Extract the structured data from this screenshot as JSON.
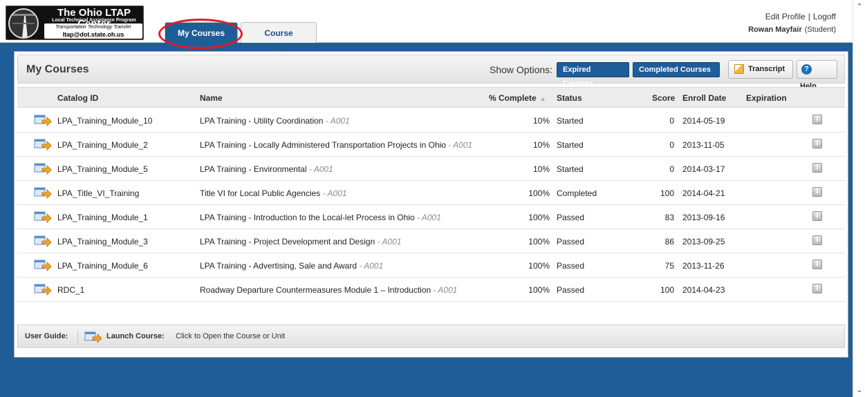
{
  "header": {
    "logo": {
      "title": "The Ohio LTAP Center",
      "subtitle": "Local Technical Assistance Program",
      "tagline": "Transportation Technology Transfer",
      "email": "ltap@dot.state.oh.us"
    },
    "tabs": [
      {
        "label": "My Courses",
        "active": true
      },
      {
        "label": "Course Catalog",
        "active": false
      }
    ],
    "links": {
      "edit_profile": "Edit Profile",
      "separator": "|",
      "logoff": "Logoff"
    },
    "user": {
      "name": "Rowan Mayfair",
      "role": "(Student)"
    }
  },
  "panel": {
    "title": "My Courses",
    "show_options_label": "Show Options:",
    "buttons": {
      "expired": "Expired Courses",
      "completed": "Completed Courses",
      "transcript": "Transcript",
      "help": "Help"
    }
  },
  "table": {
    "columns": {
      "catalog_id": "Catalog ID",
      "name": "Name",
      "pct_complete": "% Complete",
      "status": "Status",
      "score": "Score",
      "enroll_date": "Enroll Date",
      "expiration": "Expiration"
    },
    "rows": [
      {
        "id": "LPA_Training_Module_10",
        "name": "LPA Training - Utility Coordination",
        "version": " - A001",
        "pct": "10%",
        "status": "Started",
        "score": "0",
        "date": "2014-05-19"
      },
      {
        "id": "LPA_Training_Module_2",
        "name": "LPA Training - Locally Administered Transportation Projects in Ohio",
        "version": " - A001",
        "pct": "10%",
        "status": "Started",
        "score": "0",
        "date": "2013-11-05"
      },
      {
        "id": "LPA_Training_Module_5",
        "name": "LPA Training - Environmental",
        "version": " - A001",
        "pct": "10%",
        "status": "Started",
        "score": "0",
        "date": "2014-03-17"
      },
      {
        "id": "LPA_Title_VI_Training",
        "name": "Title VI for Local Public Agencies",
        "version": " - A001",
        "pct": "100%",
        "status": "Completed",
        "score": "100",
        "date": "2014-04-21"
      },
      {
        "id": "LPA_Training_Module_1",
        "name": "LPA Training - Introduction to the Local-let Process in Ohio",
        "version": " - A001",
        "pct": "100%",
        "status": "Passed",
        "score": "83",
        "date": "2013-09-16"
      },
      {
        "id": "LPA_Training_Module_3",
        "name": "LPA Training - Project Development and Design",
        "version": " - A001",
        "pct": "100%",
        "status": "Passed",
        "score": "86",
        "date": "2013-09-25"
      },
      {
        "id": "LPA_Training_Module_6",
        "name": "LPA Training - Advertising, Sale and Award",
        "version": " - A001",
        "pct": "100%",
        "status": "Passed",
        "score": "75",
        "date": "2013-11-26"
      },
      {
        "id": "RDC_1",
        "name": "Roadway Departure Countermeasures Module 1 – Introduction",
        "version": " - A001",
        "pct": "100%",
        "status": "Passed",
        "score": "100",
        "date": "2014-04-23"
      }
    ]
  },
  "guide": {
    "label": "User Guide:",
    "launch_title": "Launch Course:",
    "launch_desc": "Click to Open the Course or Unit"
  },
  "icons": {
    "launch": "launch-course-icon",
    "info": "info-icon",
    "transcript": "transcript-icon",
    "help": "help-icon"
  },
  "colors": {
    "brand_blue": "#1f5d99",
    "highlight_red": "#e21b22",
    "launch_orange": "#f5a623"
  }
}
